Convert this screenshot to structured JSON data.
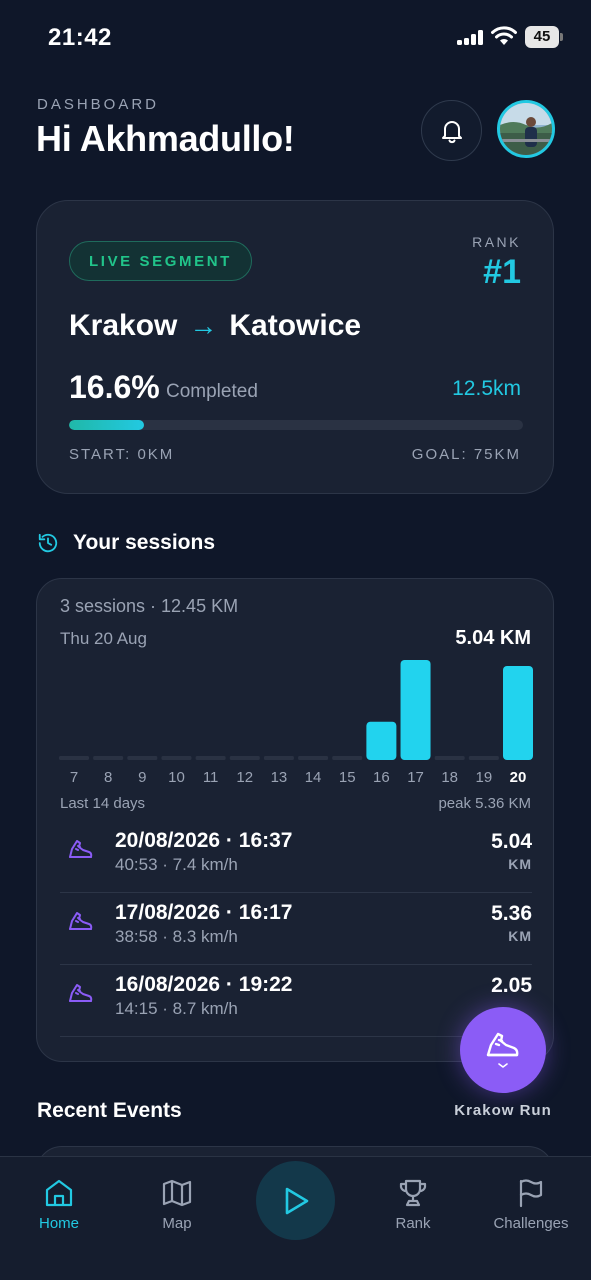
{
  "status_bar": {
    "time": "21:42",
    "battery": "45"
  },
  "header": {
    "label": "DASHBOARD",
    "greeting": "Hi Akhmadullo!"
  },
  "live_segment": {
    "badge": "LIVE SEGMENT",
    "rank_label": "RANK",
    "rank_value": "#1",
    "route_from": "Krakow",
    "route_arrow": "→",
    "route_to": "Katowice",
    "percent_text": "16.6%",
    "completed_word": "Completed",
    "progress_fraction": 0.166,
    "distance": "12.5km",
    "start_label": "START: 0KM",
    "goal_label": "GOAL: 75KM"
  },
  "sessions": {
    "title": "Your sessions",
    "summary": "3 sessions · 12.45 KM",
    "selected_date": "Thu 20 Aug",
    "selected_km": "5.04 KM",
    "caption": "Last 14 days",
    "peak": "peak 5.36 KM",
    "rows": [
      {
        "datetime": "20/08/2026 · 16:37",
        "meta": "40:53 · 7.4 km/h",
        "km": "5.04",
        "unit": "KM"
      },
      {
        "datetime": "17/08/2026 · 16:17",
        "meta": "38:58 · 8.3 km/h",
        "km": "5.36",
        "unit": "KM"
      },
      {
        "datetime": "16/08/2026 · 19:22",
        "meta": "14:15 · 8.7 km/h",
        "km": "2.05",
        "unit": ""
      }
    ]
  },
  "chart_data": {
    "type": "bar",
    "categories": [
      "7",
      "8",
      "9",
      "10",
      "11",
      "12",
      "13",
      "14",
      "15",
      "16",
      "17",
      "18",
      "19",
      "20"
    ],
    "values": [
      0,
      0,
      0,
      0,
      0,
      0,
      0,
      0,
      0,
      2.05,
      5.36,
      0,
      0,
      5.04
    ],
    "highlighted": "20",
    "ylim": [
      0,
      5.36
    ],
    "bar_color": "#22d3ee",
    "empty_color": "#2a3243"
  },
  "fab": {
    "label": "Krakow Run"
  },
  "recent": {
    "title": "Recent Events"
  },
  "nav": {
    "home": "Home",
    "map": "Map",
    "rank": "Rank",
    "challenges": "Challenges"
  },
  "colors": {
    "accent": "#22c9e2",
    "purple": "#8b5cf6",
    "green": "#21c48a",
    "background": "#0f1729"
  }
}
